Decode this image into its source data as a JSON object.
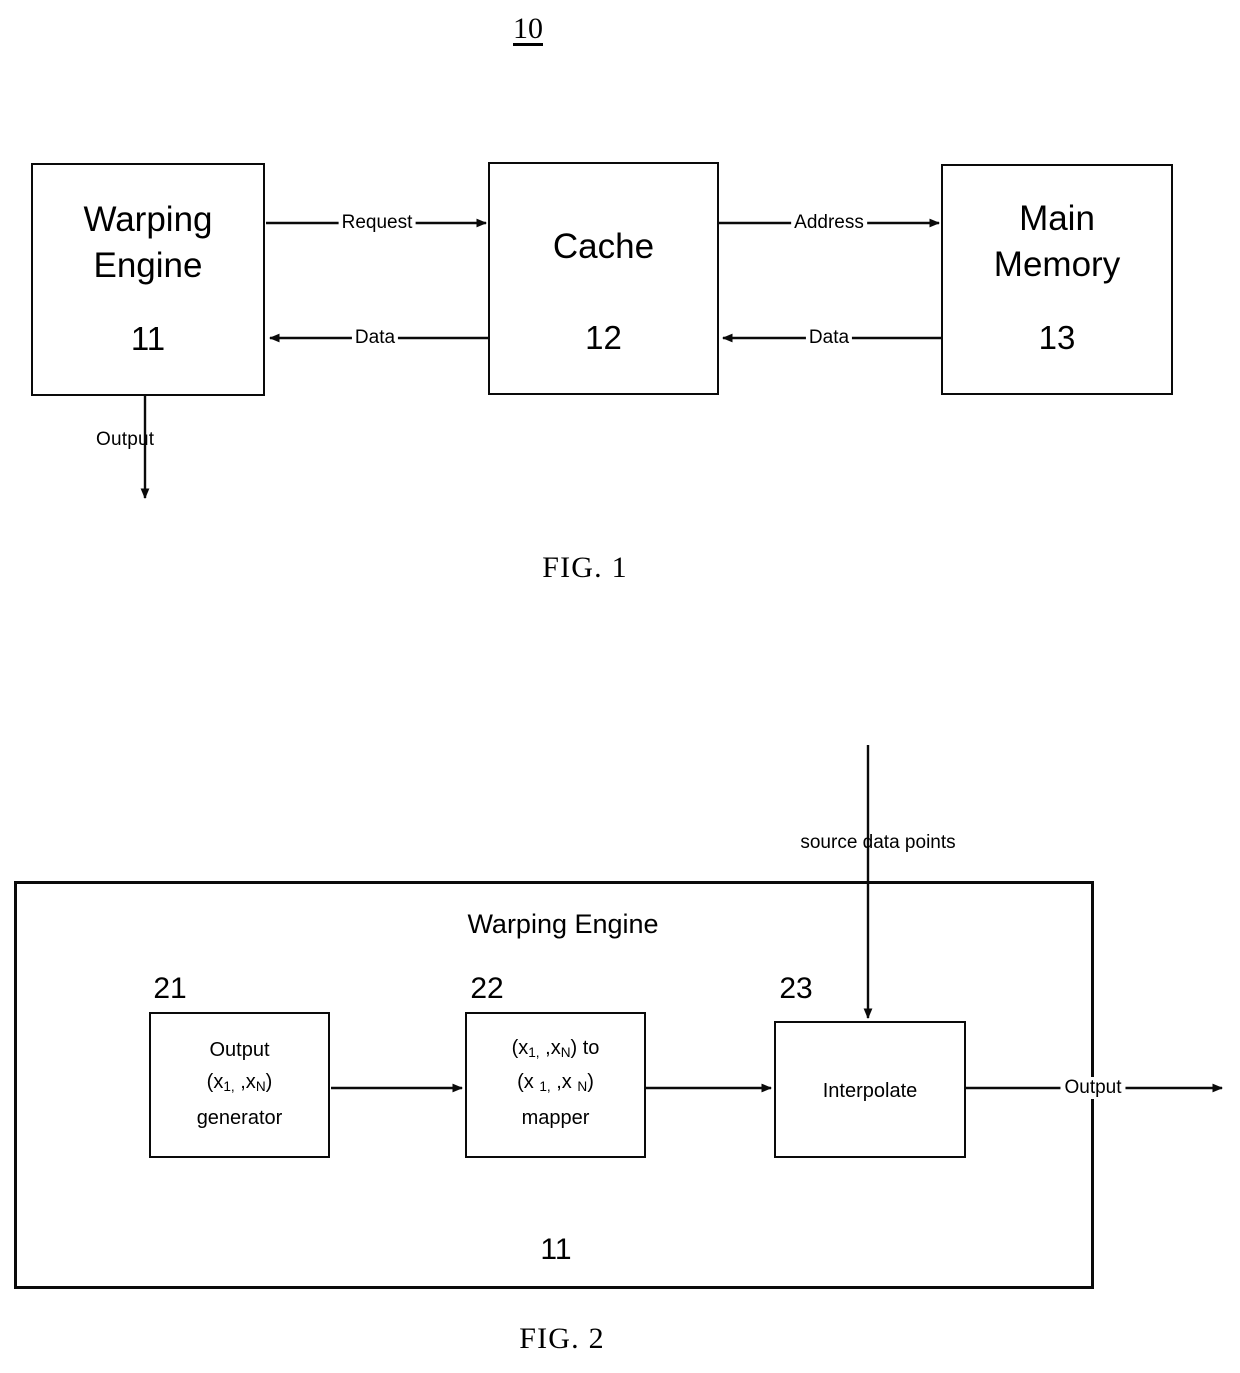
{
  "document": {
    "type": "patent-drawing-sheet",
    "figures": [
      {
        "id": "fig1",
        "caption": "FIG. 1",
        "reference_numeral": "10",
        "blocks": [
          {
            "id": "warping-engine",
            "title_line1": "Warping",
            "title_line2": "Engine",
            "numeral": "11"
          },
          {
            "id": "cache",
            "title_line1": "Cache",
            "title_line2": "",
            "numeral": "12"
          },
          {
            "id": "main-memory",
            "title_line1": "Main",
            "title_line2": "Memory",
            "numeral": "13"
          }
        ],
        "connectors": [
          {
            "id": "request",
            "label": "Request",
            "from": "warping-engine",
            "to": "cache",
            "direction": "right"
          },
          {
            "id": "data-cache-to-engine",
            "label": "Data",
            "from": "cache",
            "to": "warping-engine",
            "direction": "left"
          },
          {
            "id": "address",
            "label": "Address",
            "from": "cache",
            "to": "main-memory",
            "direction": "right"
          },
          {
            "id": "data-memory-to-cache",
            "label": "Data",
            "from": "main-memory",
            "to": "cache",
            "direction": "left"
          },
          {
            "id": "output",
            "label": "Output",
            "from": "warping-engine",
            "to": "",
            "direction": "down"
          }
        ]
      },
      {
        "id": "fig2",
        "caption": "FIG. 2",
        "container_title": "Warping Engine",
        "container_numeral": "11",
        "external_input_label": "source data points",
        "external_output_label": "Output",
        "blocks": [
          {
            "id": "output-generator",
            "numeral": "21",
            "lines": [
              "Output",
              "(x<sub>1,</sub>   ,x<sub>N</sub>)",
              "generator"
            ]
          },
          {
            "id": "coordinate-mapper",
            "numeral": "22",
            "lines": [
              "(x<sub>1,</sub>   ,x<sub>N</sub>) to",
              "(x <sub>1,</sub>   ,x <sub>N</sub>)",
              "mapper"
            ]
          },
          {
            "id": "interpolate",
            "numeral": "23",
            "lines": [
              "Interpolate"
            ]
          }
        ]
      }
    ]
  },
  "colors": {
    "ink": "#0a0a0a",
    "paper": "#ffffff"
  }
}
